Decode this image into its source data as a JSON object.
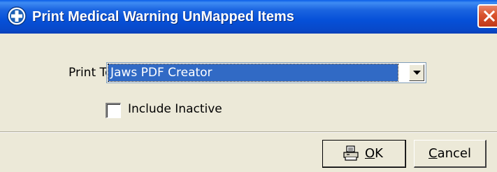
{
  "window": {
    "title": "Print Medical Warning UnMapped Items",
    "icon": "medical-cross-icon",
    "titlebar_color": "#0a5ee8",
    "close_color": "#d9522c"
  },
  "form": {
    "print_to_label": "Print To:",
    "printer_selected": "Jaws PDF Creator",
    "include_inactive_label": "Include Inactive",
    "include_inactive_checked": false,
    "selection_color": "#316ac5"
  },
  "buttons": {
    "ok_mnemonic": "O",
    "ok_rest": "K",
    "ok_icon": "printer-icon",
    "cancel_mnemonic": "C",
    "cancel_rest": "ancel"
  }
}
